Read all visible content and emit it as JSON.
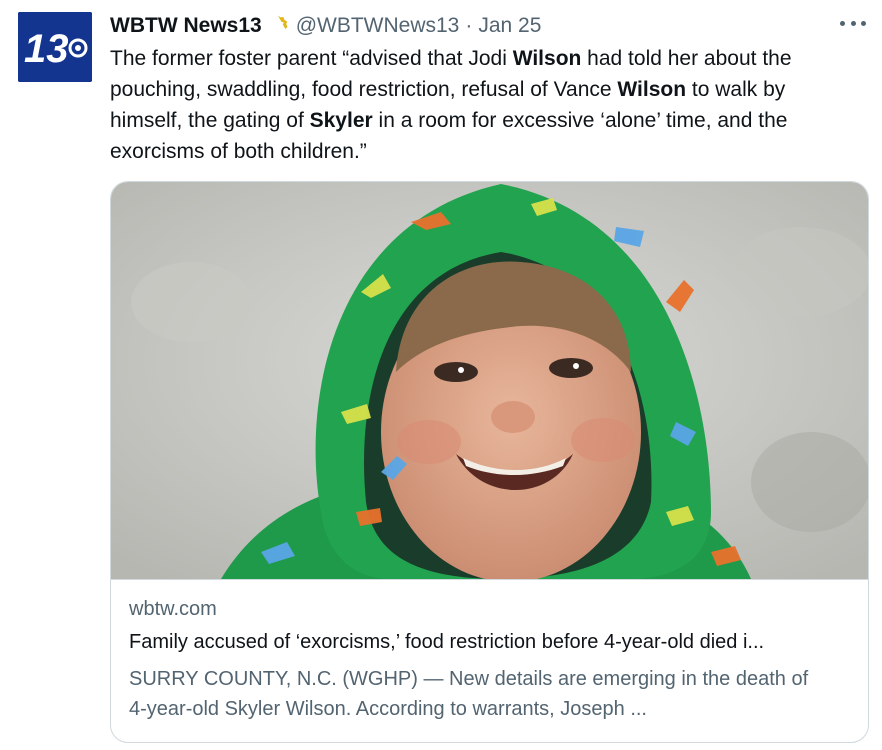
{
  "tweet": {
    "author_name": "WBTW News13",
    "handle": "@WBTWNews13",
    "separator": "·",
    "date": "Jan 25",
    "avatar_text": "13",
    "verified_icon": "verified-badge-icon",
    "more_icon": "more-options-icon",
    "text_segments": [
      "The former foster parent “advised that Jodi ",
      "Wilson",
      " had told her about the pouching, swaddling, food restriction, refusal of Vance ",
      "Wilson",
      " to walk by himself, the gating of ",
      "Skyler",
      " in a room for excessive ‘alone’ time, and the exorcisms of both children.”"
    ]
  },
  "card": {
    "domain": "wbtw.com",
    "title": "Family accused of ‘exorcisms,’ food restriction before 4-year-old died i...",
    "description": "SURRY COUNTY, N.C. (WGHP) — New details are emerging in the death of 4-year-old Skyler Wilson. According to warrants, Joseph ..."
  },
  "colors": {
    "avatar_bg": "#13358f",
    "verified_gold": "#e2b719",
    "secondary_text": "#536471",
    "border": "#cfd9de"
  }
}
